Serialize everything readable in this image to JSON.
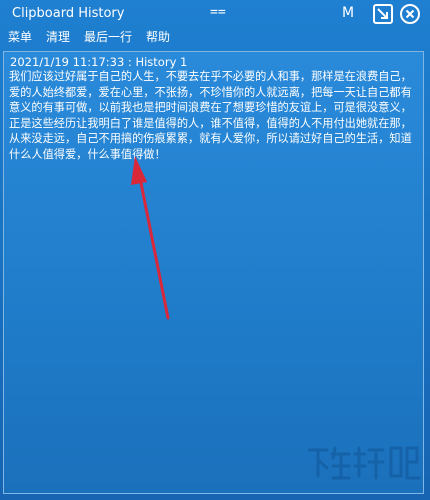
{
  "window": {
    "title": "Clipboard History",
    "title_marker": "==",
    "btn_m_label": "M"
  },
  "menu": {
    "items": [
      {
        "label": "菜单"
      },
      {
        "label": "清理"
      },
      {
        "label": "最后一行"
      },
      {
        "label": "帮助"
      }
    ]
  },
  "history": {
    "entry_header": "2021/1/19 11:17:33 : History 1",
    "entry_text": "我们应该过好属于自己的人生，不要去在乎不必要的人和事，那样是在浪费自己，爱的人始终都爱，爱在心里，不张扬，不珍惜你的人就远离，把每一天让自己都有意义的有事可做，以前我也是把时间浪费在了想要珍惜的友谊上，可是很没意义，正是这些经历让我明白了谁是值得的人，谁不值得，值得的人不用付出她就在那，从来没走远，自己不用搞的伤痕累累，就有人爱你，所以请过好自己的生活，知道什么人值得爱，什么事值得做！"
  },
  "colors": {
    "window_bg": "#1a74c4",
    "panel_border": "#7fb6e6",
    "annotation_arrow": "#d9283a"
  },
  "icons": {
    "resize": "resize-arrow-icon",
    "close": "close-icon"
  }
}
